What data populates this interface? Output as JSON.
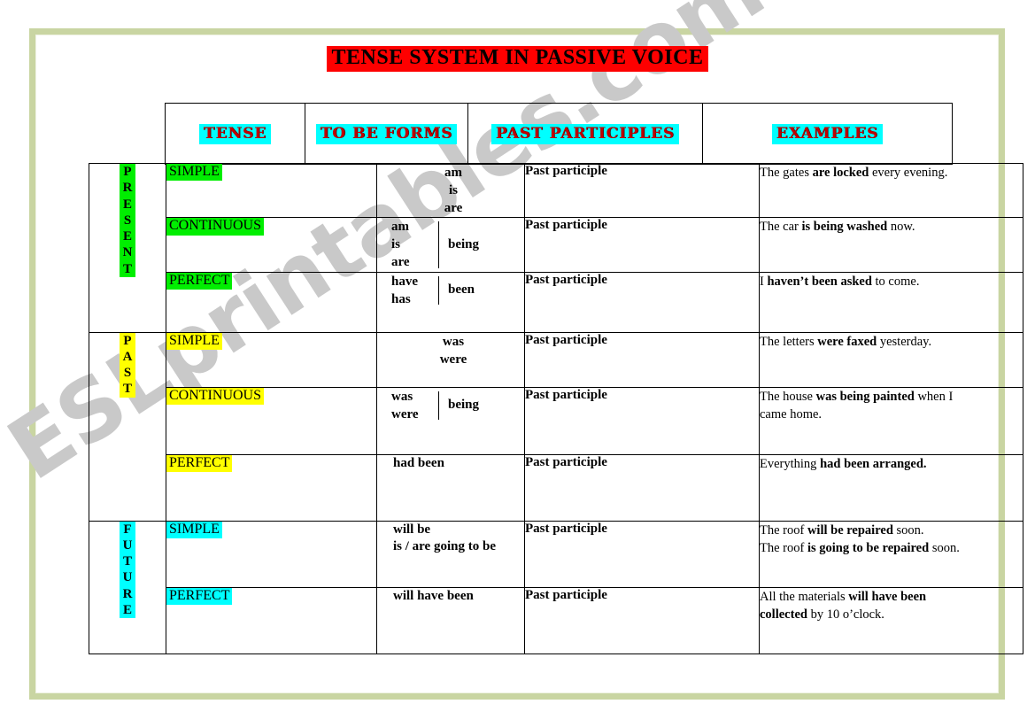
{
  "document": {
    "title": "TENSE SYSTEM IN PASSIVE VOICE",
    "watermark": "ESLprintables.com",
    "colors": {
      "title_highlight": "#fe0000",
      "header_highlight": "#00ffff",
      "header_text": "#c00000",
      "present_highlight": "#00ee00",
      "past_highlight": "#ffff00",
      "future_highlight": "#00ffff",
      "frame": "#c9d5a2",
      "watermark": "#c9c9c9"
    }
  },
  "table": {
    "headers": {
      "tense": "TENSE",
      "to_be_forms": "TO BE FORMS",
      "past_participles": "PAST PARTICIPLES",
      "examples": "EXAMPLES"
    },
    "past_participle_label": "Past participle",
    "groups": [
      {
        "name": "PRESENT",
        "letters": [
          "P",
          "R",
          "E",
          "S",
          "E",
          "N",
          "T"
        ],
        "highlight": "green",
        "rows": [
          {
            "tense": "SIMPLE",
            "to_be": {
              "layout": "stack-center",
              "left": [
                "am",
                "is",
                "are"
              ],
              "right": ""
            },
            "past_participle": "Past participle",
            "example_lines": [
              [
                {
                  "t": "The gates ",
                  "b": false
                },
                {
                  "t": "are locked",
                  "b": true
                },
                {
                  "t": " every evening.",
                  "b": false
                }
              ]
            ]
          },
          {
            "tense": "CONTINUOUS",
            "to_be": {
              "layout": "split",
              "left": [
                "am",
                "is",
                "are"
              ],
              "right": "being"
            },
            "past_participle": "Past participle",
            "example_lines": [
              [
                {
                  "t": "The car ",
                  "b": false
                },
                {
                  "t": "is being washed",
                  "b": true
                },
                {
                  "t": " now.",
                  "b": false
                }
              ]
            ]
          },
          {
            "tense": "PERFECT",
            "to_be": {
              "layout": "split",
              "left": [
                "have",
                "has"
              ],
              "right": "been"
            },
            "past_participle": "Past participle",
            "example_lines": [
              [
                {
                  "t": "I ",
                  "b": false
                },
                {
                  "t": "haven’t been asked",
                  "b": true
                },
                {
                  "t": " to come.",
                  "b": false
                }
              ]
            ]
          }
        ]
      },
      {
        "name": "PAST",
        "letters": [
          "P",
          "A",
          "S",
          "T"
        ],
        "highlight": "yellow",
        "rows": [
          {
            "tense": "SIMPLE",
            "to_be": {
              "layout": "stack-center",
              "left": [
                "was",
                "were"
              ],
              "right": ""
            },
            "past_participle": "Past participle",
            "example_lines": [
              [
                {
                  "t": "The letters ",
                  "b": false
                },
                {
                  "t": "were faxed",
                  "b": true
                },
                {
                  "t": " yesterday.",
                  "b": false
                }
              ]
            ]
          },
          {
            "tense": "CONTINUOUS",
            "to_be": {
              "layout": "split",
              "left": [
                "was",
                "were"
              ],
              "right": "being"
            },
            "past_participle": "Past participle",
            "example_lines": [
              [
                {
                  "t": "The house ",
                  "b": false
                },
                {
                  "t": "was being painted",
                  "b": true
                },
                {
                  "t": " when I",
                  "b": false
                }
              ],
              [
                {
                  "t": "came home.",
                  "b": false
                }
              ]
            ]
          },
          {
            "tense": "PERFECT",
            "to_be": {
              "layout": "plain-left",
              "left": [
                "had been"
              ],
              "right": ""
            },
            "past_participle": "Past participle",
            "example_lines": [
              [
                {
                  "t": "Everything ",
                  "b": false
                },
                {
                  "t": "had been arranged.",
                  "b": true
                }
              ]
            ]
          }
        ]
      },
      {
        "name": "FUTURE",
        "letters": [
          "F",
          "U",
          "T",
          "U",
          "R",
          "E"
        ],
        "highlight": "cyan",
        "rows": [
          {
            "tense": "SIMPLE",
            "to_be": {
              "layout": "stack-left",
              "left": [
                "will be",
                "is / are going to be"
              ],
              "right": ""
            },
            "past_participle": "Past participle",
            "example_lines": [
              [
                {
                  "t": "The roof ",
                  "b": false
                },
                {
                  "t": "will be repaired",
                  "b": true
                },
                {
                  "t": " soon.",
                  "b": false
                }
              ],
              [
                {
                  "t": "The roof ",
                  "b": false
                },
                {
                  "t": "is going to be repaired",
                  "b": true
                },
                {
                  "t": " soon.",
                  "b": false
                }
              ]
            ]
          },
          {
            "tense": "PERFECT",
            "to_be": {
              "layout": "plain-left",
              "left": [
                "will have been"
              ],
              "right": ""
            },
            "past_participle": "Past participle",
            "example_lines": [
              [
                {
                  "t": "All the materials ",
                  "b": false
                },
                {
                  "t": "will have been",
                  "b": true
                }
              ],
              [
                {
                  "t": "collected",
                  "b": true
                },
                {
                  "t": " by 10 o’clock.",
                  "b": false
                }
              ]
            ]
          }
        ]
      }
    ]
  }
}
